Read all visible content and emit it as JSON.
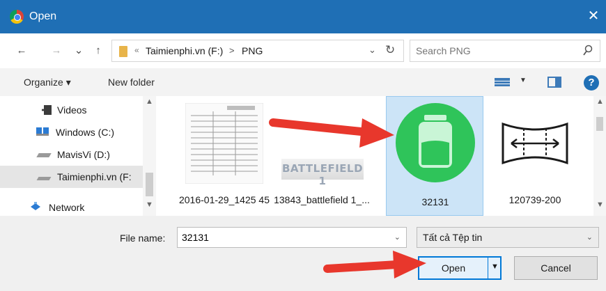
{
  "window": {
    "title": "Open",
    "close_glyph": "✕"
  },
  "nav_buttons": {
    "back": "←",
    "forward": "→",
    "recent": "⌄",
    "up": "↑"
  },
  "address": {
    "chevron": "«",
    "crumbs": [
      "Taimienphi.vn (F:)",
      "PNG"
    ],
    "separator": ">",
    "dropdown_glyph": "⌄",
    "refresh_glyph": "↻"
  },
  "search": {
    "placeholder": "Search PNG"
  },
  "toolbar": {
    "organize_label": "Organize ▾",
    "new_folder_label": "New folder",
    "view_arrow": "▼",
    "help_label": "?"
  },
  "sidebar": {
    "items": [
      {
        "label": "Videos",
        "icon": "video-folder-icon"
      },
      {
        "label": "Windows (C:)",
        "icon": "windows-drive-icon"
      },
      {
        "label": "MavisVi (D:)",
        "icon": "drive-icon"
      },
      {
        "label": "Taimienphi.vn (F:",
        "icon": "drive-icon",
        "selected": true
      },
      {
        "label": "Network",
        "icon": "network-icon"
      }
    ],
    "scroll_up": "▲",
    "scroll_down": "▼"
  },
  "files": {
    "items": [
      {
        "name": "2016-01-29_1425 45",
        "thumb": "spreadsheet-thumbnail"
      },
      {
        "name": "13843_battlefield 1_...",
        "thumb": "battlefield-thumbnail",
        "overlay_text": "BATTLEFIELD 1"
      },
      {
        "name": "32131",
        "thumb": "battery-app-icon",
        "selected": true
      },
      {
        "name": "120739-200",
        "thumb": "stretch-icon"
      }
    ],
    "scroll_up": "▲",
    "scroll_down": "▼"
  },
  "bottom": {
    "file_name_label": "File name:",
    "file_name_value": "32131",
    "dropdown_glyph": "⌄",
    "filter_value": "Tất cả Tệp tin",
    "open_label": "Open",
    "open_split_glyph": "▼",
    "cancel_label": "Cancel"
  },
  "colors": {
    "titlebar": "#1f6fb5",
    "selection": "#cce4f7",
    "annotation_arrow": "#e8372c",
    "battery_green": "#2fc45a"
  }
}
